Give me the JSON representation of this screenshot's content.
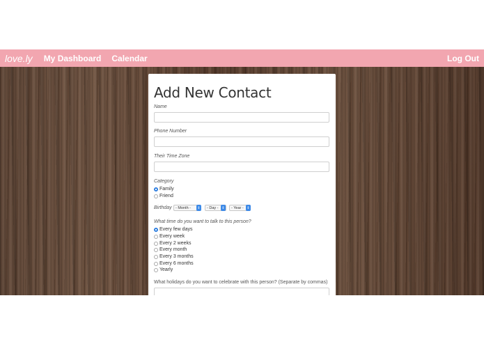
{
  "navbar": {
    "brand": "love.ly",
    "links": [
      "My Dashboard",
      "Calendar"
    ],
    "logout": "Log Out"
  },
  "form": {
    "title": "Add New Contact",
    "name_label": "Name",
    "name_value": "",
    "phone_label": "Phone Number",
    "phone_value": "",
    "timezone_label": "Their Time Zone",
    "timezone_value": "",
    "category_label": "Category",
    "category_options": [
      "Family",
      "Friend"
    ],
    "category_selected": "Family",
    "birthday_label": "Birthday",
    "birthday_month": "- Month -",
    "birthday_day": "- Day -",
    "birthday_year": "- Year -",
    "frequency_label": "What time do you want to talk to this person?",
    "frequency_options": [
      "Every few days",
      "Every week",
      "Every 2 weeks",
      "Every month",
      "Every 3 months",
      "Every 6 months",
      "Yearly"
    ],
    "frequency_selected": "Every few days",
    "holidays_label": "What holidays do you want to celebrate with this person? (Separate by commas)",
    "holidays_value": ""
  },
  "colors": {
    "navbar": "#f2a6b0",
    "accent": "#2f7fe0"
  },
  "icons": {
    "select_arrow": "chevron-updown-icon",
    "radio": "radio-button-icon"
  }
}
